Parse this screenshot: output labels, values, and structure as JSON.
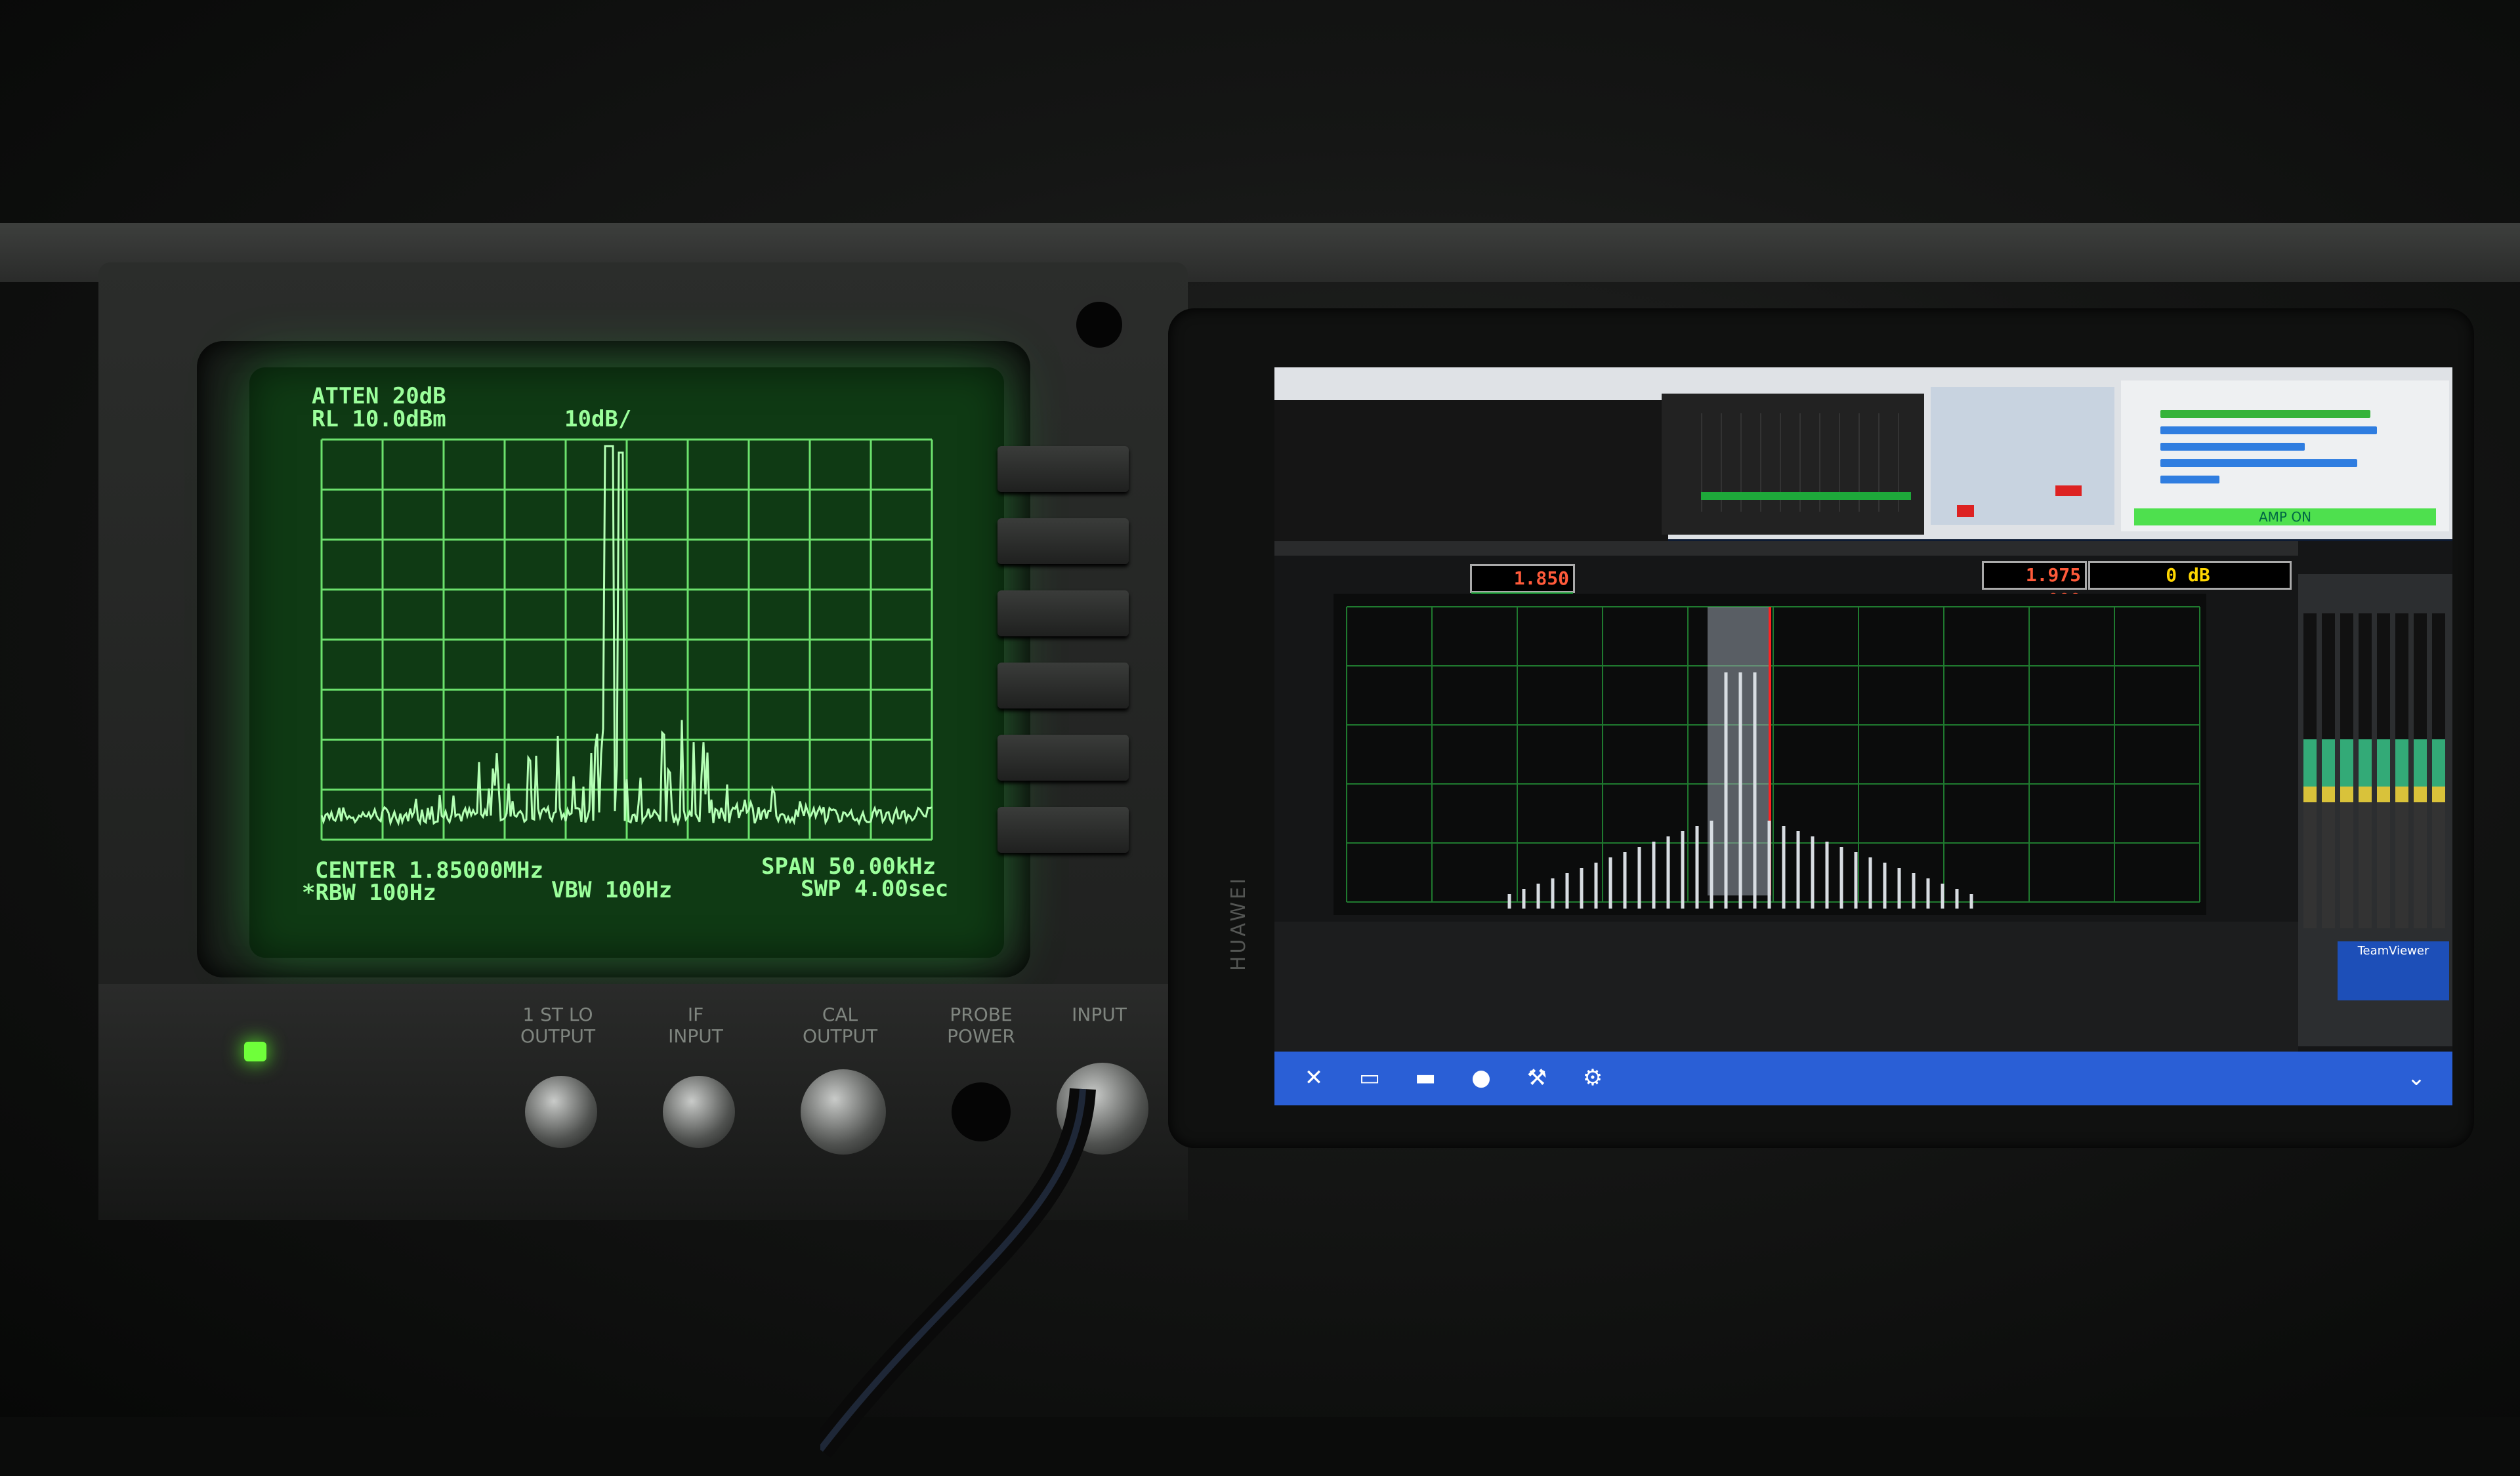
{
  "analyzer": {
    "atten": "ATTEN 20dB",
    "ref_level": "RL 10.0dBm",
    "scale": "10dB/",
    "center": "CENTER 1.85000MHz",
    "span": "SPAN 50.00kHz",
    "rbw": "*RBW 100Hz",
    "vbw": "VBW 100Hz",
    "sweep": "SWP 4.00sec",
    "panel_labels": {
      "lo_output": "1 ST LO\nOUTPUT",
      "if_input": "IF\nINPUT",
      "cal_output": "CAL\nOUTPUT",
      "probe_power": "PROBE\nPOWER",
      "input": "INPUT"
    },
    "led_color": "#6fff3a",
    "trace_color": "#9bff9b"
  },
  "tablet": {
    "brand": "HUAWEI",
    "vfo_a": "1.850 000",
    "vfo_b": "1.975 000",
    "level_readout": "0 dB",
    "amp_status": "AMP ON",
    "panel_app": "TeamViewer",
    "taskbar_icons": [
      "close-icon",
      "screen-icon",
      "chat-icon",
      "user-icon",
      "wrench-icon",
      "gear-icon",
      "chevron-down-icon"
    ],
    "taskbar_color": "#2a5fd6"
  }
}
